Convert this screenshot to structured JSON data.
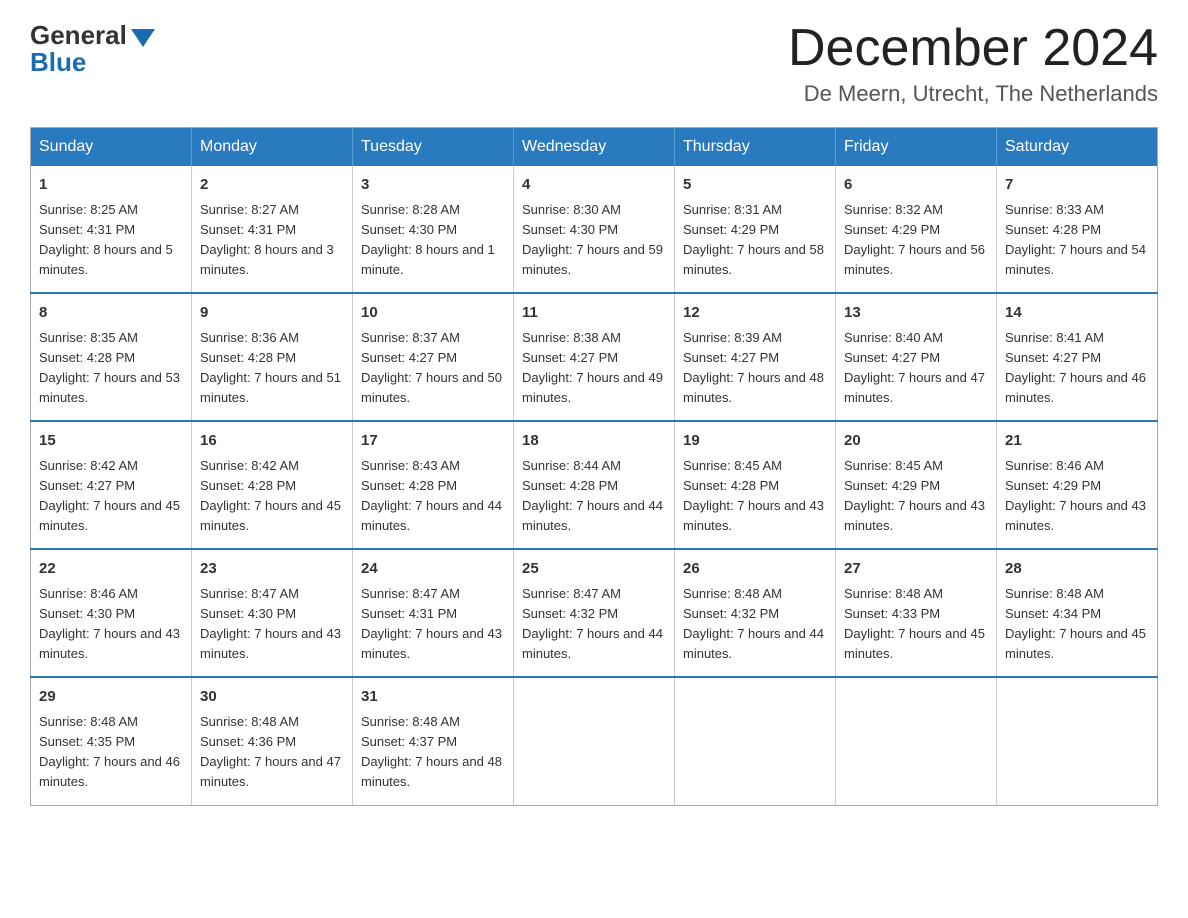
{
  "header": {
    "logo_general": "General",
    "logo_blue": "Blue",
    "month_title": "December 2024",
    "location": "De Meern, Utrecht, The Netherlands"
  },
  "days_of_week": [
    "Sunday",
    "Monday",
    "Tuesday",
    "Wednesday",
    "Thursday",
    "Friday",
    "Saturday"
  ],
  "weeks": [
    [
      {
        "day": "1",
        "sunrise": "8:25 AM",
        "sunset": "4:31 PM",
        "daylight": "8 hours and 5 minutes."
      },
      {
        "day": "2",
        "sunrise": "8:27 AM",
        "sunset": "4:31 PM",
        "daylight": "8 hours and 3 minutes."
      },
      {
        "day": "3",
        "sunrise": "8:28 AM",
        "sunset": "4:30 PM",
        "daylight": "8 hours and 1 minute."
      },
      {
        "day": "4",
        "sunrise": "8:30 AM",
        "sunset": "4:30 PM",
        "daylight": "7 hours and 59 minutes."
      },
      {
        "day": "5",
        "sunrise": "8:31 AM",
        "sunset": "4:29 PM",
        "daylight": "7 hours and 58 minutes."
      },
      {
        "day": "6",
        "sunrise": "8:32 AM",
        "sunset": "4:29 PM",
        "daylight": "7 hours and 56 minutes."
      },
      {
        "day": "7",
        "sunrise": "8:33 AM",
        "sunset": "4:28 PM",
        "daylight": "7 hours and 54 minutes."
      }
    ],
    [
      {
        "day": "8",
        "sunrise": "8:35 AM",
        "sunset": "4:28 PM",
        "daylight": "7 hours and 53 minutes."
      },
      {
        "day": "9",
        "sunrise": "8:36 AM",
        "sunset": "4:28 PM",
        "daylight": "7 hours and 51 minutes."
      },
      {
        "day": "10",
        "sunrise": "8:37 AM",
        "sunset": "4:27 PM",
        "daylight": "7 hours and 50 minutes."
      },
      {
        "day": "11",
        "sunrise": "8:38 AM",
        "sunset": "4:27 PM",
        "daylight": "7 hours and 49 minutes."
      },
      {
        "day": "12",
        "sunrise": "8:39 AM",
        "sunset": "4:27 PM",
        "daylight": "7 hours and 48 minutes."
      },
      {
        "day": "13",
        "sunrise": "8:40 AM",
        "sunset": "4:27 PM",
        "daylight": "7 hours and 47 minutes."
      },
      {
        "day": "14",
        "sunrise": "8:41 AM",
        "sunset": "4:27 PM",
        "daylight": "7 hours and 46 minutes."
      }
    ],
    [
      {
        "day": "15",
        "sunrise": "8:42 AM",
        "sunset": "4:27 PM",
        "daylight": "7 hours and 45 minutes."
      },
      {
        "day": "16",
        "sunrise": "8:42 AM",
        "sunset": "4:28 PM",
        "daylight": "7 hours and 45 minutes."
      },
      {
        "day": "17",
        "sunrise": "8:43 AM",
        "sunset": "4:28 PM",
        "daylight": "7 hours and 44 minutes."
      },
      {
        "day": "18",
        "sunrise": "8:44 AM",
        "sunset": "4:28 PM",
        "daylight": "7 hours and 44 minutes."
      },
      {
        "day": "19",
        "sunrise": "8:45 AM",
        "sunset": "4:28 PM",
        "daylight": "7 hours and 43 minutes."
      },
      {
        "day": "20",
        "sunrise": "8:45 AM",
        "sunset": "4:29 PM",
        "daylight": "7 hours and 43 minutes."
      },
      {
        "day": "21",
        "sunrise": "8:46 AM",
        "sunset": "4:29 PM",
        "daylight": "7 hours and 43 minutes."
      }
    ],
    [
      {
        "day": "22",
        "sunrise": "8:46 AM",
        "sunset": "4:30 PM",
        "daylight": "7 hours and 43 minutes."
      },
      {
        "day": "23",
        "sunrise": "8:47 AM",
        "sunset": "4:30 PM",
        "daylight": "7 hours and 43 minutes."
      },
      {
        "day": "24",
        "sunrise": "8:47 AM",
        "sunset": "4:31 PM",
        "daylight": "7 hours and 43 minutes."
      },
      {
        "day": "25",
        "sunrise": "8:47 AM",
        "sunset": "4:32 PM",
        "daylight": "7 hours and 44 minutes."
      },
      {
        "day": "26",
        "sunrise": "8:48 AM",
        "sunset": "4:32 PM",
        "daylight": "7 hours and 44 minutes."
      },
      {
        "day": "27",
        "sunrise": "8:48 AM",
        "sunset": "4:33 PM",
        "daylight": "7 hours and 45 minutes."
      },
      {
        "day": "28",
        "sunrise": "8:48 AM",
        "sunset": "4:34 PM",
        "daylight": "7 hours and 45 minutes."
      }
    ],
    [
      {
        "day": "29",
        "sunrise": "8:48 AM",
        "sunset": "4:35 PM",
        "daylight": "7 hours and 46 minutes."
      },
      {
        "day": "30",
        "sunrise": "8:48 AM",
        "sunset": "4:36 PM",
        "daylight": "7 hours and 47 minutes."
      },
      {
        "day": "31",
        "sunrise": "8:48 AM",
        "sunset": "4:37 PM",
        "daylight": "7 hours and 48 minutes."
      },
      null,
      null,
      null,
      null
    ]
  ]
}
